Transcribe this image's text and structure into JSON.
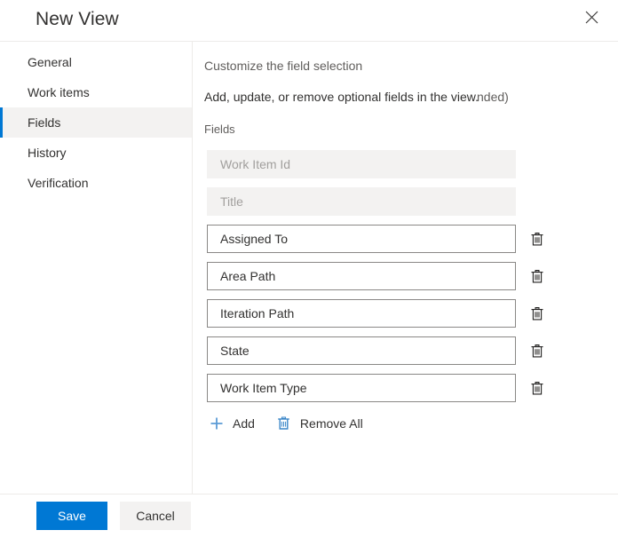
{
  "dialog": {
    "title": "New View",
    "close_icon": "close-icon"
  },
  "sidebar": {
    "items": [
      {
        "label": "General",
        "selected": false
      },
      {
        "label": "Work items",
        "selected": false
      },
      {
        "label": "Fields",
        "selected": true
      },
      {
        "label": "History",
        "selected": false
      },
      {
        "label": "Verification",
        "selected": false
      }
    ]
  },
  "main": {
    "heading": "Customize the field selection",
    "description": "Add, update, or remove optional fields in the view.",
    "description_fragment": "nded)",
    "fields_label": "Fields",
    "fields": [
      {
        "value": "Work Item Id",
        "disabled": true,
        "deletable": false
      },
      {
        "value": "Title",
        "disabled": true,
        "deletable": false
      },
      {
        "value": "Assigned To",
        "disabled": false,
        "deletable": true
      },
      {
        "value": "Area Path",
        "disabled": false,
        "deletable": true
      },
      {
        "value": "Iteration Path",
        "disabled": false,
        "deletable": true
      },
      {
        "value": "State",
        "disabled": false,
        "deletable": true
      },
      {
        "value": "Work Item Type",
        "disabled": false,
        "deletable": true
      }
    ],
    "actions": {
      "add_label": "Add",
      "add_icon": "plus-icon",
      "remove_all_label": "Remove All",
      "remove_all_icon": "trash-icon"
    },
    "row_delete_icon": "trash-icon"
  },
  "footer": {
    "save_label": "Save",
    "cancel_label": "Cancel"
  },
  "colors": {
    "accent": "#0078d4",
    "selected_bg": "#f3f2f1",
    "text_primary": "#323130",
    "text_secondary": "#605e5c",
    "placeholder": "#a19f9d",
    "border": "#8a8886",
    "divider": "#edebe9"
  }
}
